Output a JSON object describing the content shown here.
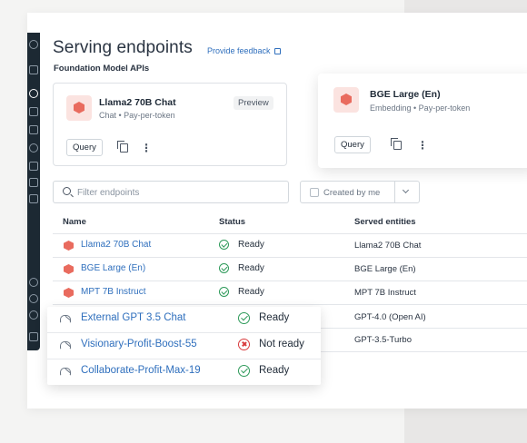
{
  "page": {
    "title": "Serving endpoints",
    "feedback_link": "Provide feedback",
    "section_title": "Foundation Model APIs"
  },
  "cards": [
    {
      "name": "Llama2 70B Chat",
      "subtitle": "Chat • Pay-per-token",
      "badge": "Preview",
      "query_label": "Query"
    },
    {
      "name": "BGE Large (En)",
      "subtitle": "Embedding • Pay-per-token",
      "query_label": "Query"
    }
  ],
  "filter": {
    "placeholder": "Filter endpoints",
    "created_by_label": "Created by me"
  },
  "table": {
    "columns": [
      "Name",
      "Status",
      "Served entities"
    ],
    "rows": [
      {
        "name": "Llama2 70B Chat",
        "status": "Ready",
        "served": "Llama2 70B Chat"
      },
      {
        "name": "BGE Large (En)",
        "status": "Ready",
        "served": "BGE Large (En)"
      },
      {
        "name": "MPT 7B Instruct",
        "status": "Ready",
        "served": "MPT 7B Instruct"
      }
    ],
    "partial_served": [
      "GPT-4.0 (Open AI)",
      "GPT-3.5-Turbo"
    ]
  },
  "popup_rows": [
    {
      "name": "External GPT 3.5 Chat",
      "status": "Ready",
      "status_type": "ok"
    },
    {
      "name": "Visionary-Profit-Boost-55",
      "status": "Not ready",
      "status_type": "error"
    },
    {
      "name": "Collaborate-Profit-Max-19",
      "status": "Ready",
      "status_type": "ok"
    }
  ],
  "colors": {
    "link": "#2f6fbd",
    "ready": "#2e9a5a",
    "not_ready": "#d8393b",
    "model_accent": "#e96b5e",
    "sidebar": "#1c2933"
  }
}
